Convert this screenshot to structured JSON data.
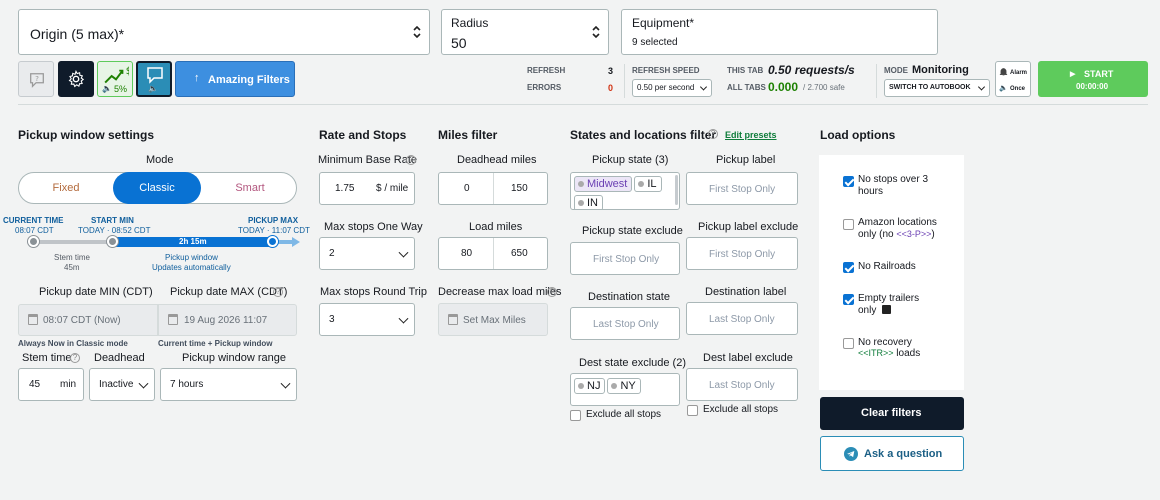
{
  "top": {
    "origin_value": "Origin (5 max)*",
    "radius_label": "Radius",
    "radius_value": "50",
    "equipment_label": "Equipment*",
    "equipment_value": "9 selected"
  },
  "toolbar": {
    "speed_percent": "5%",
    "amazing_filters_label": "Amazing Filters",
    "refresh_label": "REFRESH",
    "refresh_value": "3",
    "errors_label": "ERRORS",
    "errors_value": "0",
    "refresh_speed_label": "REFRESH SPEED",
    "refresh_speed_value": "0.50 per second",
    "this_tab_label": "THIS TAB",
    "this_tab_value": "0.50 requests/s",
    "all_tabs_label": "ALL TABS",
    "all_tabs_value": "0.000",
    "all_tabs_suffix": "/ 2.700 safe",
    "mode_label": "MODE",
    "mode_value": "Monitoring",
    "mode_select": "SWITCH TO AUTOBOOK",
    "alarm_label": "Alarm",
    "once_label": "Once",
    "start_label": "START",
    "start_timer": "00:00:00"
  },
  "pickup": {
    "title": "Pickup window settings",
    "mode_label": "Mode",
    "modes": [
      "Fixed",
      "Classic",
      "Smart"
    ],
    "active_mode": "Classic",
    "current_time_label": "CURRENT TIME",
    "current_time_value": "08:07 CDT",
    "start_min_label": "START MIN",
    "start_min_value": "TODAY · 08:52 CDT",
    "pickup_max_label": "PICKUP MAX",
    "pickup_max_value": "TODAY · 11:07 CDT",
    "window_duration": "2h 15m",
    "stem_time_label": "Stem time",
    "stem_time_value": "45m",
    "window_label": "Pickup window",
    "window_sub": "Updates automatically",
    "date_min_label": "Pickup date MIN (CDT)",
    "date_max_label": "Pickup date MAX (CDT)",
    "date_min_value": "08:07 CDT (Now)",
    "date_max_value": "19 Aug 2026 11:07",
    "date_min_note": "Always Now in Classic mode",
    "date_max_note": "Current time + Pickup window",
    "stem_field_label": "Stem time",
    "stem_field_value": "45",
    "stem_field_unit": "min",
    "deadhead_label": "Deadhead",
    "deadhead_value": "Inactive",
    "range_label": "Pickup window range",
    "range_value": "7 hours"
  },
  "rate": {
    "title": "Rate and Stops",
    "min_rate_label": "Minimum Base Rate",
    "min_rate_value": "1.75",
    "min_rate_unit": "$ / mile",
    "stops_one_way_label": "Max stops One Way",
    "stops_one_way_value": "2",
    "stops_round_label": "Max stops Round Trip",
    "stops_round_value": "3"
  },
  "miles": {
    "title": "Miles filter",
    "deadhead_label": "Deadhead miles",
    "deadhead_min": "0",
    "deadhead_max": "150",
    "load_label": "Load miles",
    "load_min": "80",
    "load_max": "650",
    "decrease_label": "Decrease max load miles",
    "decrease_placeholder": "Set Max Miles"
  },
  "states": {
    "title": "States and locations filter",
    "edit_presets": "Edit presets",
    "pickup_state_label": "Pickup state (3)",
    "pickup_state_chips": [
      "Midwest",
      "IL",
      "IN"
    ],
    "pickup_label_label": "Pickup label",
    "pickup_label_ph": "First Stop Only",
    "pickup_state_excl_label": "Pickup state exclude",
    "pickup_state_excl_ph": "First Stop Only",
    "pickup_label_excl_label": "Pickup label exclude",
    "pickup_label_excl_ph": "First Stop Only",
    "dest_state_label": "Destination state",
    "dest_state_ph": "Last Stop Only",
    "dest_label_label": "Destination label",
    "dest_label_ph": "Last Stop Only",
    "dest_state_excl_label": "Dest state exclude (2)",
    "dest_state_excl_chips": [
      "NJ",
      "NY"
    ],
    "dest_label_excl_label": "Dest label exclude",
    "dest_label_excl_ph": "Last Stop Only",
    "exclude_all_stops": "Exclude all stops"
  },
  "load_options": {
    "title": "Load options",
    "opt1_line1": "No stops over 3",
    "opt1_line2": "hours",
    "opt2_line1": "Amazon locations",
    "opt2_line2a": "only (no ",
    "opt2_line2b": "<<3-P>>",
    "opt2_line2c": ")",
    "opt3": "No Railroads",
    "opt4_line1": "Empty trailers",
    "opt4_line2": "only",
    "opt5_line1": "No recovery",
    "opt5_line2a": "<<ITR>>",
    "opt5_line2b": " loads",
    "clear_filters": "Clear filters",
    "ask_question": "Ask a question"
  },
  "colors": {
    "accent_blue": "#0972d3",
    "start_green": "#5ecb5c",
    "dark_navy": "#0f1b2a",
    "pink_text": "#b3577f",
    "error_red": "#d13212"
  }
}
